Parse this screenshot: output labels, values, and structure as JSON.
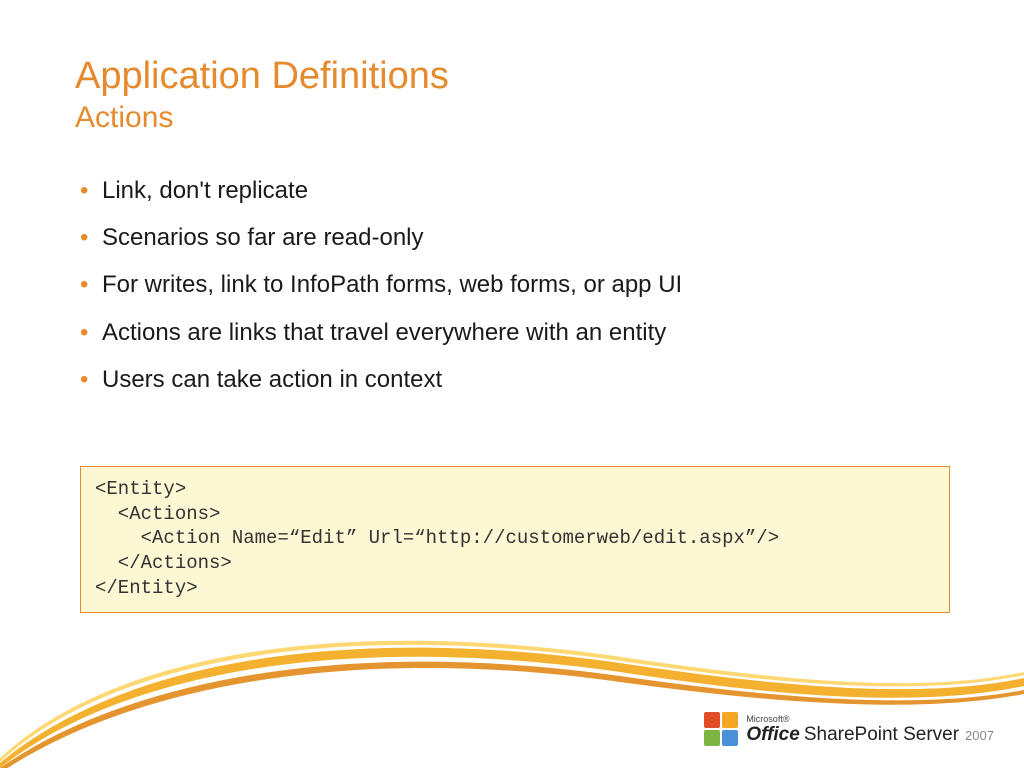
{
  "title": {
    "main": "Application Definitions",
    "sub": "Actions"
  },
  "bullets": [
    "Link, don't replicate",
    "Scenarios so far are read-only",
    "For writes, link to InfoPath forms, web forms, or app UI",
    "Actions are links that travel everywhere with an entity",
    "Users can take action in context"
  ],
  "code": "<Entity>\n  <Actions>\n    <Action Name=“Edit” Url=“http://customerweb/edit.aspx”/>\n  </Actions>\n</Entity>",
  "brand": {
    "ms": "Microsoft®",
    "office": "Office",
    "product": "SharePoint Server",
    "year": "2007"
  }
}
